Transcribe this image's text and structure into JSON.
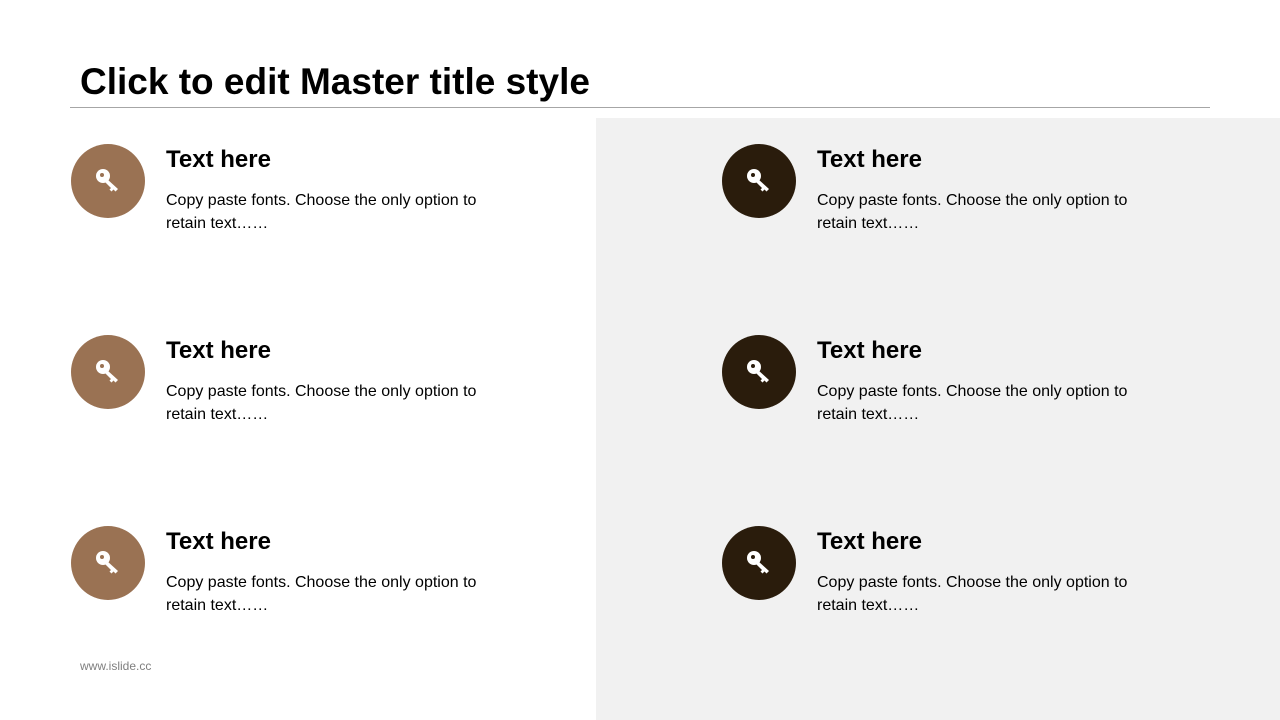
{
  "title": "Click to edit Master title style",
  "colors": {
    "left_accent": "#9a7253",
    "right_accent": "#2a1c0c",
    "right_panel": "#f1f1f1"
  },
  "items": [
    {
      "icon": "key-icon",
      "heading": "Text here",
      "body": "Copy paste fonts. Choose the only option to retain text……"
    },
    {
      "icon": "key-icon",
      "heading": "Text here",
      "body": "Copy paste fonts. Choose the only option to retain text……"
    },
    {
      "icon": "key-icon",
      "heading": "Text here",
      "body": "Copy paste fonts. Choose the only option to retain text……"
    },
    {
      "icon": "key-icon",
      "heading": "Text here",
      "body": "Copy paste fonts. Choose the only option to retain text……"
    },
    {
      "icon": "key-icon",
      "heading": "Text here",
      "body": "Copy paste fonts. Choose the only option to retain text……"
    },
    {
      "icon": "key-icon",
      "heading": "Text here",
      "body": "Copy paste fonts. Choose the only option to retain text……"
    }
  ],
  "footer": "www.islide.cc"
}
